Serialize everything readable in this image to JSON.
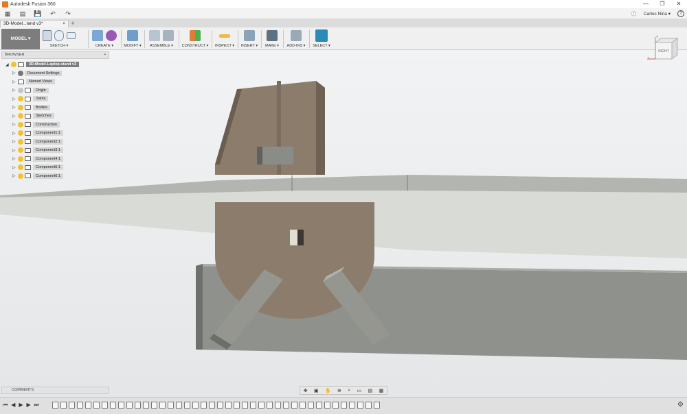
{
  "window": {
    "title": "Autodesk Fusion 360",
    "minimize": "—",
    "restore": "❐",
    "close": "✕"
  },
  "quick_access": {
    "grid": "▦",
    "file": "▤",
    "save": "💾",
    "undo": "↶",
    "redo": "↷"
  },
  "user": {
    "name": "Carlos Nina ▾",
    "clock": "🕐",
    "help": "?"
  },
  "tab": {
    "name": "3D-Model...tand v3*",
    "close": "×",
    "add": "+"
  },
  "workspace": {
    "label": "MODEL ▾"
  },
  "ribbon": [
    {
      "label": "SKETCH ▾"
    },
    {
      "label": "CREATE ▾"
    },
    {
      "label": "MODIFY ▾"
    },
    {
      "label": "ASSEMBLE ▾"
    },
    {
      "label": "CONSTRUCT ▾"
    },
    {
      "label": "INSPECT ▾"
    },
    {
      "label": "INSERT ▾"
    },
    {
      "label": "MAKE ▾"
    },
    {
      "label": "ADD-INS ▾"
    },
    {
      "label": "SELECT ▾"
    }
  ],
  "browser": {
    "header": "BROWSER",
    "root": "3D-Model-Laptop-stand v3",
    "items": [
      {
        "label": "Document Settings"
      },
      {
        "label": "Named Views"
      },
      {
        "label": "Origin"
      },
      {
        "label": "Joints"
      },
      {
        "label": "Bodies"
      },
      {
        "label": "Sketches"
      },
      {
        "label": "Construction"
      },
      {
        "label": "Component1:1"
      },
      {
        "label": "Component2:1"
      },
      {
        "label": "Component3:1"
      },
      {
        "label": "Component4:1"
      },
      {
        "label": "Component5:1"
      },
      {
        "label": "Component6:1"
      }
    ]
  },
  "comments": {
    "label": "COMMENTS"
  },
  "viewcube": {
    "face": "RIGHT",
    "axis_x": "X",
    "axis_y": "Y",
    "axis_z": "Z"
  },
  "colors": {
    "accent": "#2a8ab8",
    "bulb": "#f2c230",
    "ribbon_bg": "#f0f0f0",
    "body_wood": "#8c7c6b",
    "body_grey": "#8f918d"
  }
}
